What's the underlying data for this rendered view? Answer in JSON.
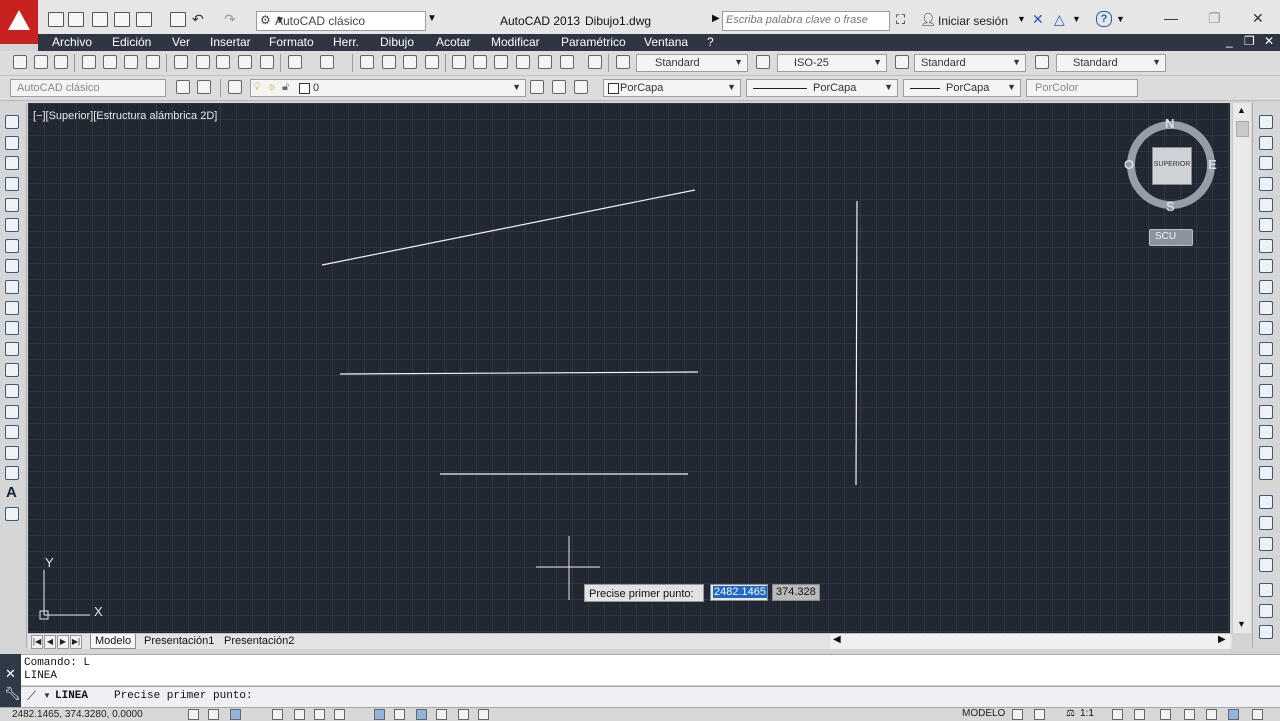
{
  "titlebar": {
    "workspace": "AutoCAD clásico",
    "app_title": "AutoCAD 2013",
    "file_name": "Dibujo1.dwg",
    "search_placeholder": "Escriba palabra clave o frase",
    "signin": "Iniciar sesión"
  },
  "menu": [
    {
      "label": "Archivo"
    },
    {
      "label": "Edición"
    },
    {
      "label": "Ver"
    },
    {
      "label": "Insertar"
    },
    {
      "label": "Formato"
    },
    {
      "label": "Herr."
    },
    {
      "label": "Dibujo"
    },
    {
      "label": "Acotar"
    },
    {
      "label": "Modificar"
    },
    {
      "label": "Paramétrico"
    },
    {
      "label": "Ventana"
    },
    {
      "label": "?"
    }
  ],
  "toolbar1": {
    "text_style": "Standard",
    "dim_style": "ISO-25",
    "table_style": "Standard",
    "multileader_style": "Standard"
  },
  "toolbar2": {
    "workspace": "AutoCAD clásico",
    "layer": "0",
    "color": "PorCapa",
    "linetype": "PorCapa",
    "lineweight": "PorCapa",
    "plotstyle": "PorColor"
  },
  "viewport": {
    "label": "[−][Superior][Estructura alámbrica 2D]"
  },
  "viewcube": {
    "north": "N",
    "south": "S",
    "east": "E",
    "west": "O",
    "face": "SUPERIOR",
    "ucs": "SCU"
  },
  "ucs_icon": {
    "x_label": "X",
    "y_label": "Y"
  },
  "tabs": [
    {
      "label": "Modelo",
      "active": true
    },
    {
      "label": "Presentación1",
      "active": false
    },
    {
      "label": "Presentación2",
      "active": false
    }
  ],
  "dynamic_input": {
    "prompt": "Precise primer punto:",
    "x_value": "2482.1465",
    "y_value": "374.328"
  },
  "command": {
    "history": [
      "Comando: L",
      "LINEA"
    ],
    "current_keyword": "LINEA",
    "current_prompt": "Precise primer punto:"
  },
  "statusbar": {
    "coordinates": "2482.1465, 374.3280, 0.0000",
    "space": "MODELO",
    "scale": "1:1"
  },
  "colors": {
    "canvas_bg": "#212831",
    "grid": "#2e3743",
    "menubar": "#2f3542",
    "logo": "#c8221f",
    "selection": "#1f66c9"
  }
}
